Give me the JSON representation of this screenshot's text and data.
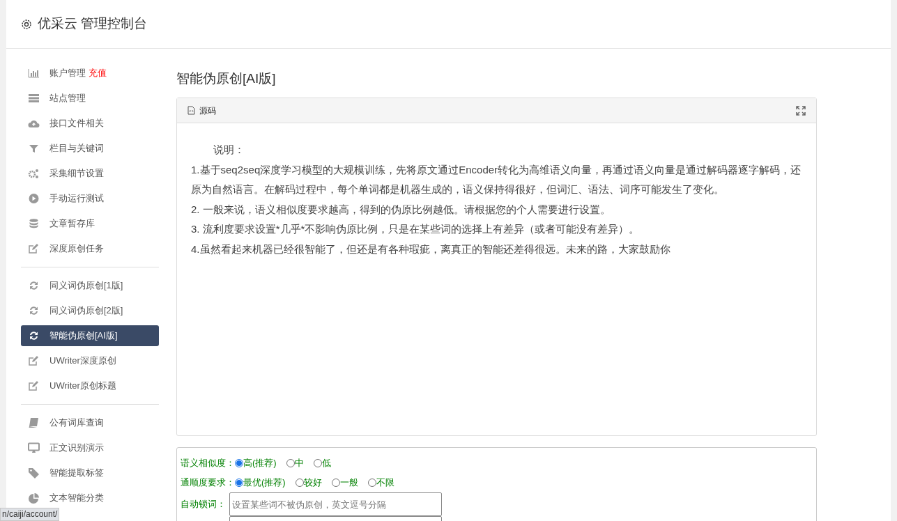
{
  "header": {
    "title": "优采云 管理控制台"
  },
  "sidebar": {
    "groups": [
      {
        "items": [
          {
            "label": "账户管理",
            "badge": "充值",
            "selected": false
          },
          {
            "label": "站点管理",
            "selected": false
          },
          {
            "label": "接口文件相关",
            "selected": false
          },
          {
            "label": "栏目与关键词",
            "selected": false
          },
          {
            "label": "采集细节设置",
            "selected": false
          },
          {
            "label": "手动运行测试",
            "selected": false
          },
          {
            "label": "文章暂存库",
            "selected": false
          },
          {
            "label": "深度原创任务",
            "selected": false
          }
        ]
      },
      {
        "items": [
          {
            "label": "同义词伪原创[1版]",
            "selected": false
          },
          {
            "label": "同义词伪原创[2版]",
            "selected": false
          },
          {
            "label": "智能伪原创[AI版]",
            "selected": true
          },
          {
            "label": "UWriter深度原创",
            "selected": false
          },
          {
            "label": "UWriter原创标题",
            "selected": false
          }
        ]
      },
      {
        "items": [
          {
            "label": "公有词库查询",
            "selected": false
          },
          {
            "label": "正文识别演示",
            "selected": false
          },
          {
            "label": "智能提取标签",
            "selected": false
          },
          {
            "label": "文本智能分类",
            "selected": false
          }
        ]
      }
    ]
  },
  "page_title": "智能伪原创[AI版]",
  "editor": {
    "toolbar_label": "源码",
    "paragraphs": [
      "说明：",
      "1.基于seq2seq深度学习模型的大规模训练，先将原文通过Encoder转化为高维语义向量，再通过语义向量是通过解码器逐字解码，还原为自然语言。在解码过程中，每个单词都是机器生成的，语义保持得很好，但词汇、语法、词序可能发生了变化。",
      "2. 一般来说，语义相似度要求越高，得到的伪原比例越低。请根据您的个人需要进行设置。",
      "3. 流利度要求设置*几乎*不影响伪原比例，只是在某些词的选择上有差异（或者可能没有差异）。",
      "4.虽然看起来机器已经很智能了，但还是有各种瑕疵，离真正的智能还差得很远。未来的路，大家鼓励你"
    ]
  },
  "form": {
    "rows": [
      {
        "kind": "radio",
        "label": "语义相似度：",
        "options": [
          {
            "label": "高(推荐)",
            "selected": true
          },
          {
            "label": "中",
            "selected": false
          },
          {
            "label": "低",
            "selected": false
          }
        ]
      },
      {
        "kind": "radio",
        "label": "通顺度要求：",
        "options": [
          {
            "label": "最优(推荐)",
            "selected": true
          },
          {
            "label": "较好",
            "selected": false
          },
          {
            "label": "一般",
            "selected": false
          },
          {
            "label": "不限",
            "selected": false
          }
        ]
      },
      {
        "kind": "input",
        "label": "自动锁词：",
        "placeholder": "设置某些词不被伪原创，英文逗号分隔"
      },
      {
        "kind": "textarea"
      }
    ]
  },
  "status_url": "n/caiji/account/"
}
